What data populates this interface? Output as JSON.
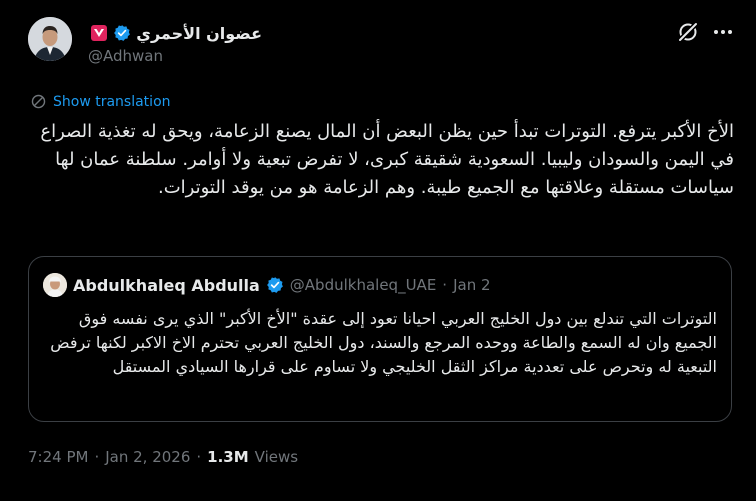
{
  "author": {
    "name": "عضوان الأحمري",
    "handle": "@Adhwan",
    "avatar": "profile-photo"
  },
  "icons": {
    "verified": "verified-badge-icon",
    "affiliate": "red-affiliate-badge-icon",
    "grok": "grok-icon",
    "more": "more-options-icon",
    "translate": "translate-icon"
  },
  "colors": {
    "background": "#000000",
    "text": "#e7e9ea",
    "muted": "#71767b",
    "accent": "#1d9bf0",
    "border": "#3b3f44",
    "badge_red": "#e0245e"
  },
  "translation": {
    "label": "Show translation"
  },
  "tweet": {
    "text": "الأخ الأكبر يترفع. التوترات تبدأ حين يظن البعض أن المال يصنع الزعامة، ويحق له تغذية الصراع في اليمن والسودان وليبيا. السعودية شقيقة كبرى، لا تفرض تبعية ولا أوامر. سلطنة عمان لها سياسات مستقلة وعلاقتها مع الجميع طيبة. وهم الزعامة هو من يوقد التوترات."
  },
  "quote": {
    "name": "Abdulkhaleq Abdulla",
    "handle": "@Abdulkhaleq_UAE",
    "separator": "·",
    "date": "Jan 2",
    "text": "التوترات التي تندلع بين دول الخليج العربي احيانا تعود إلى عقدة \"الأخ الأكبر\" الذي يرى نفسه فوق الجميع وان له السمع والطاعة ووحده المرجع والسند، دول الخليج العربي تحترم الاخ الاكبر لكنها ترفض التبعية له وتحرص على تعددية مراكز الثقل الخليجي ولا تساوم على قرارها السيادي المستقل"
  },
  "meta": {
    "time": "7:24 PM",
    "separator": "·",
    "date": "Jan 2, 2026",
    "views_count": "1.3M",
    "views_label": "Views"
  }
}
